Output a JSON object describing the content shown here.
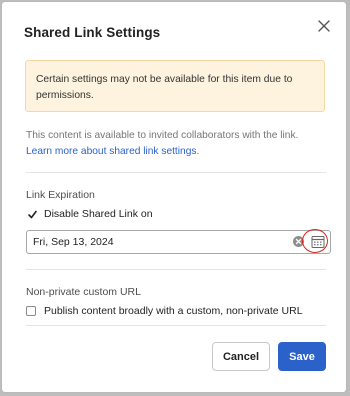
{
  "dialog": {
    "title": "Shared Link Settings",
    "close_label": "close"
  },
  "notice": {
    "text": "Certain settings may not be available for this item due to permissions."
  },
  "info": {
    "text": "This content is available to invited collaborators with the link.",
    "link_text": "Learn more about shared link settings."
  },
  "expiration": {
    "section_label": "Link Expiration",
    "checkbox_label": "Disable Shared Link on",
    "checkbox_checked": true,
    "date_value": "Fri, Sep 13, 2024"
  },
  "custom_url": {
    "section_label": "Non-private custom URL",
    "checkbox_label": "Publish content broadly with a custom, non-private URL",
    "checkbox_checked": false
  },
  "footer": {
    "cancel_label": "Cancel",
    "save_label": "Save"
  },
  "colors": {
    "primary": "#2a62c9",
    "notice_bg": "#fdf3de",
    "highlight_ring": "#d9261c"
  },
  "icons": {
    "close": "close-icon",
    "checkmark": "checkmark-icon",
    "clear": "clear-icon",
    "calendar": "calendar-icon"
  }
}
